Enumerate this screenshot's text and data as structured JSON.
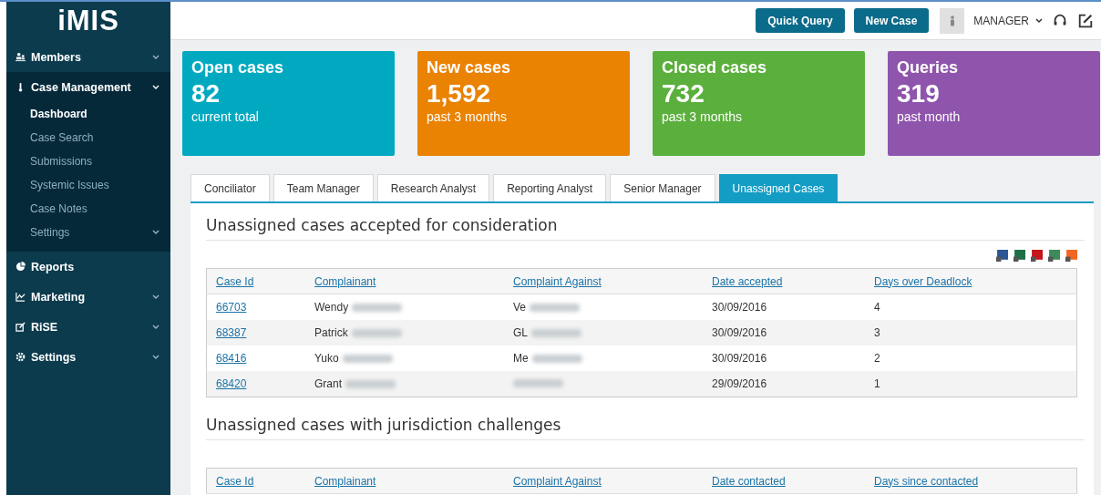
{
  "logo": "iMIS",
  "sidebar": {
    "items": [
      {
        "label": "Members",
        "expandable": true,
        "expanded": false
      },
      {
        "label": "Case Management",
        "expandable": true,
        "expanded": true,
        "children": [
          {
            "label": "Dashboard",
            "selected": true,
            "expandable": false
          },
          {
            "label": "Case Search",
            "selected": false,
            "expandable": false
          },
          {
            "label": "Submissions",
            "selected": false,
            "expandable": false
          },
          {
            "label": "Systemic Issues",
            "selected": false,
            "expandable": false
          },
          {
            "label": "Case Notes",
            "selected": false,
            "expandable": false
          },
          {
            "label": "Settings",
            "selected": false,
            "expandable": true
          }
        ]
      },
      {
        "label": "Reports",
        "expandable": false,
        "expanded": false
      },
      {
        "label": "Marketing",
        "expandable": true,
        "expanded": false
      },
      {
        "label": "RiSE",
        "expandable": true,
        "expanded": false
      },
      {
        "label": "Settings",
        "expandable": true,
        "expanded": false
      }
    ]
  },
  "topbar": {
    "buttons": [
      "Quick Query",
      "New Case"
    ],
    "user": "MANAGER"
  },
  "cards": [
    {
      "title": "Open cases",
      "value": "82",
      "caption": "current total",
      "color": "#00a9c0"
    },
    {
      "title": "New cases",
      "value": "1,592",
      "caption": "past 3 months",
      "color": "#ea8202"
    },
    {
      "title": "Closed cases",
      "value": "732",
      "caption": "past 3 months",
      "color": "#5baf3c"
    },
    {
      "title": "Queries",
      "value": "319",
      "caption": "past month",
      "color": "#8f55ad"
    }
  ],
  "tabs": [
    {
      "label": "Conciliator",
      "selected": false
    },
    {
      "label": "Team Manager",
      "selected": false
    },
    {
      "label": "Research Analyst",
      "selected": false
    },
    {
      "label": "Reporting Analyst",
      "selected": false
    },
    {
      "label": "Senior Manager",
      "selected": false
    },
    {
      "label": "Unassigned Cases",
      "selected": true
    }
  ],
  "sections": [
    {
      "title": "Unassigned cases accepted for consideration",
      "columns": [
        "Case Id",
        "Complainant",
        "Complaint Against",
        "Date accepted",
        "Days over Deadlock"
      ],
      "rows": [
        {
          "case_id": "66703",
          "complainant": "Wendy",
          "against": "Ve",
          "date": "30/09/2016",
          "days": "4"
        },
        {
          "case_id": "68387",
          "complainant": "Patrick",
          "against": "GL",
          "date": "30/09/2016",
          "days": "3"
        },
        {
          "case_id": "68416",
          "complainant": "Yuko",
          "against": "Me",
          "date": "30/09/2016",
          "days": "2"
        },
        {
          "case_id": "68420",
          "complainant": "Grant",
          "date": "29/09/2016",
          "days": "1"
        }
      ]
    },
    {
      "title": "Unassigned cases with jurisdiction challenges",
      "columns": [
        "Case Id",
        "Complainant",
        "Complaint Against",
        "Date contacted",
        "Days since contacted"
      ]
    }
  ]
}
